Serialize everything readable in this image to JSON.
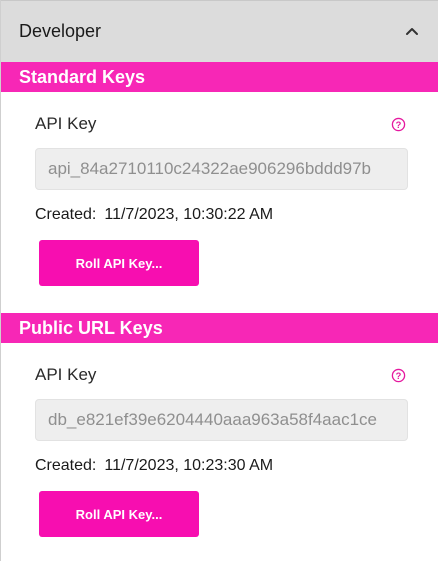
{
  "header": {
    "title": "Developer",
    "chevron_icon": "chevron-up-icon"
  },
  "colors": {
    "accent": "#f727b6",
    "button": "#f70eb0",
    "header_bg": "#dcdcdc"
  },
  "standard_keys": {
    "title": "Standard Keys",
    "api_key_label": "API Key",
    "help_icon": "question-circle-icon",
    "api_key_value": "api_84a2710110c24322ae906296bddd97b",
    "created_label": "Created:",
    "created_value": "11/7/2023, 10:30:22 AM",
    "roll_label": "Roll API Key..."
  },
  "public_url_keys": {
    "title": "Public URL Keys",
    "api_key_label": "API Key",
    "help_icon": "question-circle-icon",
    "api_key_value": "db_e821ef39e6204440aaa963a58f4aac1ce",
    "created_label": "Created:",
    "created_value": "11/7/2023, 10:23:30 AM",
    "roll_label": "Roll API Key..."
  }
}
